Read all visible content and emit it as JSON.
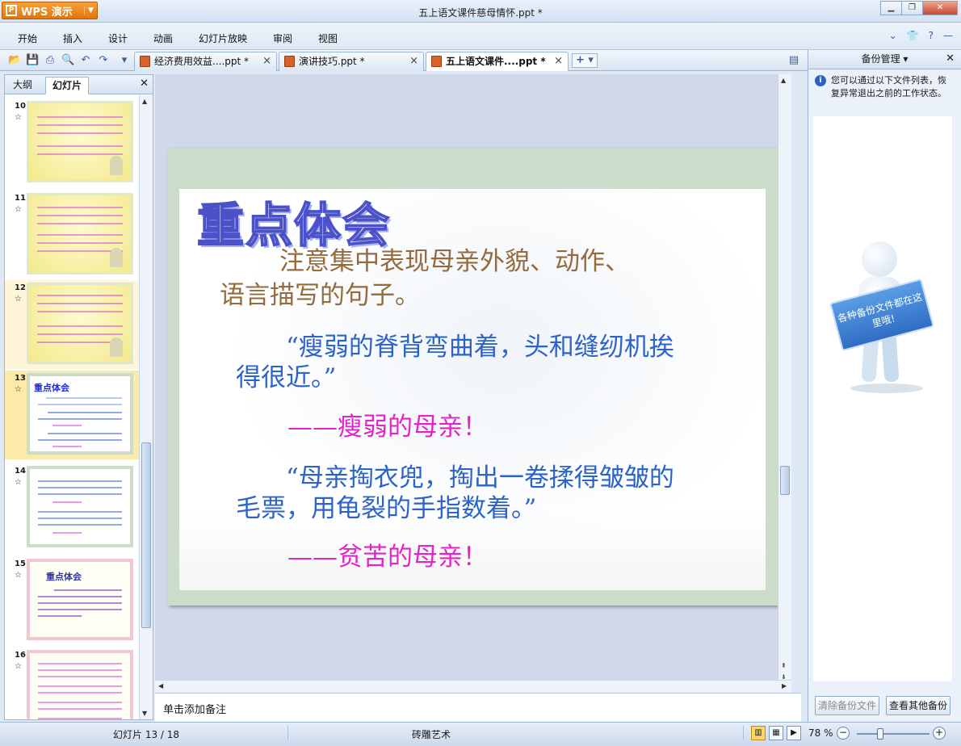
{
  "app": {
    "name": "WPS 演示",
    "window_title": "五上语文课件慈母情怀.ppt *"
  },
  "menu": [
    "开始",
    "插入",
    "设计",
    "动画",
    "幻灯片放映",
    "审阅",
    "视图"
  ],
  "doc_tabs": [
    {
      "label": "经济费用效益....ppt *",
      "active": false
    },
    {
      "label": "演讲技巧.ppt *",
      "active": false
    },
    {
      "label": "五上语文课件....ppt *",
      "active": true
    }
  ],
  "left_panel": {
    "tabs": [
      "大纲",
      "幻灯片"
    ],
    "active_tab": "幻灯片",
    "thumbnails": [
      {
        "num": "10",
        "style": "yellow"
      },
      {
        "num": "11",
        "style": "yellow"
      },
      {
        "num": "12",
        "style": "yellow"
      },
      {
        "num": "13",
        "style": "blue",
        "title": "重点体会",
        "selected": true
      },
      {
        "num": "14",
        "style": "blue"
      },
      {
        "num": "15",
        "style": "floral",
        "title": "重点体会"
      },
      {
        "num": "16",
        "style": "floral"
      }
    ]
  },
  "slide": {
    "title": "重点体会",
    "line1a": "注意集中表现母亲外貌、动作、",
    "line1b": "语言描写的句子。",
    "quote1a": "“瘦弱的脊背弯曲着，头和缝纫机挨",
    "quote1b": "得很近。”",
    "note1": "——瘦弱的母亲！",
    "quote2a": "“母亲掏衣兜，掏出一卷揉得皱皱的",
    "quote2b": "毛票，用龟裂的手指数着。”",
    "note2": "——贫苦的母亲！"
  },
  "notes_placeholder": "单击添加备注",
  "right_panel": {
    "title": "备份管理",
    "info": "您可以通过以下文件列表，恢复异常退出之前的工作状态。",
    "sign_text": "各种备份文件都在这里哦!",
    "btn_clear": "清除备份文件",
    "btn_view": "查看其他备份"
  },
  "status": {
    "slide_info": "幻灯片 13 / 18",
    "theme": "砖雕艺术",
    "zoom": "78 %"
  }
}
